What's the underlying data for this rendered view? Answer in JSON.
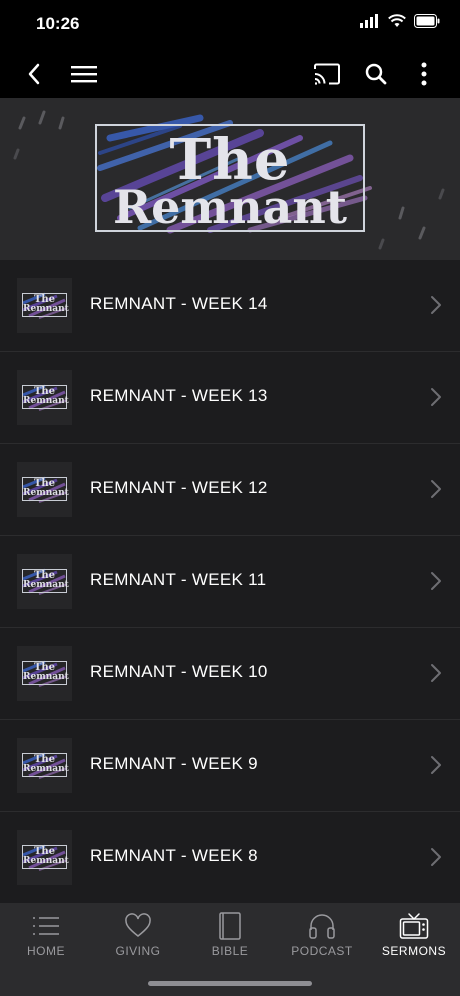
{
  "status": {
    "time": "10:26"
  },
  "navbar": {
    "back_icon": "chevron-left-icon",
    "menu_icon": "hamburger-icon",
    "cast_icon": "cast-icon",
    "search_icon": "search-icon",
    "more_icon": "more-vertical-icon"
  },
  "hero": {
    "title_line1": "The",
    "title_line2": "Remnant"
  },
  "thumb": {
    "line1": "The",
    "line2": "Remnant"
  },
  "sermons": [
    {
      "label": "REMNANT - WEEK 14"
    },
    {
      "label": "REMNANT - WEEK 13"
    },
    {
      "label": "REMNANT - WEEK 12"
    },
    {
      "label": "REMNANT - WEEK 11"
    },
    {
      "label": "REMNANT - WEEK 10"
    },
    {
      "label": "REMNANT - WEEK 9"
    },
    {
      "label": "REMNANT - WEEK 8"
    }
  ],
  "tabs": [
    {
      "label": "HOME",
      "icon": "list-icon"
    },
    {
      "label": "GIVING",
      "icon": "heart-icon"
    },
    {
      "label": "BIBLE",
      "icon": "book-icon"
    },
    {
      "label": "PODCAST",
      "icon": "headphones-icon"
    },
    {
      "label": "SERMONS",
      "icon": "tv-icon",
      "active": true
    }
  ],
  "colors": {
    "background": "#1c1c1e",
    "tabbar": "#2c2c2e",
    "active_tab": "#ffffff",
    "inactive_tab": "#9a9a9e"
  }
}
